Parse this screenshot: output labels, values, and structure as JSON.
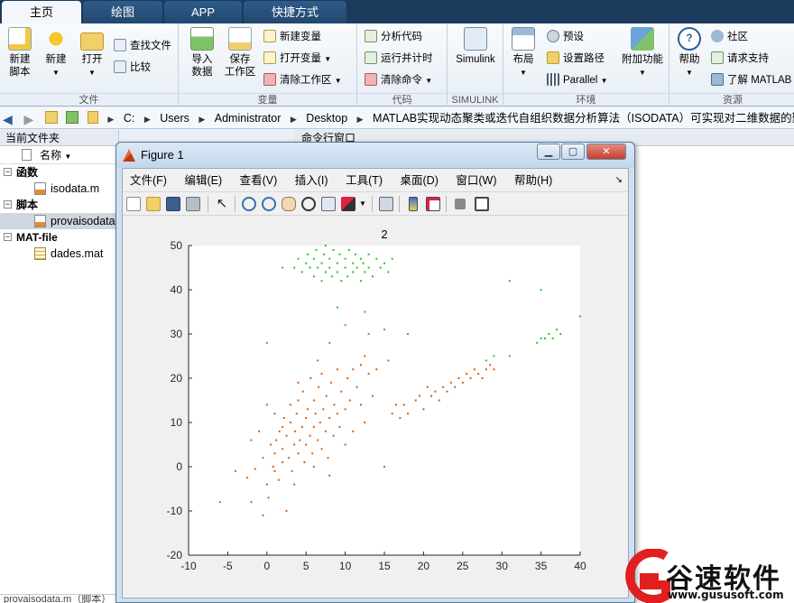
{
  "tabs": [
    {
      "label": "主页",
      "active": true
    },
    {
      "label": "绘图",
      "active": false
    },
    {
      "label": "APP",
      "active": false
    },
    {
      "label": "快捷方式",
      "active": false
    }
  ],
  "ribbon": {
    "file": {
      "label": "文件",
      "new_script": "新建\n脚本",
      "new": "新建",
      "open": "打开",
      "find_files": "查找文件",
      "compare": "比较"
    },
    "variable": {
      "label": "变量",
      "import": "导入\n数据",
      "save": "保存\n工作区",
      "new_var": "新建变量",
      "open_var": "打开变量",
      "clear_ws": "清除工作区"
    },
    "code": {
      "label": "代码",
      "analyze": "分析代码",
      "run_time": "运行并计时",
      "clear_cmd": "清除命令"
    },
    "simulink": {
      "label": "SIMULINK",
      "simulink": "Simulink"
    },
    "env": {
      "label": "环境",
      "layout": "布局",
      "prefs": "预设",
      "set_path": "设置路径",
      "parallel": "Parallel",
      "addons": "附加功能"
    },
    "resources": {
      "label": "资源",
      "help": "帮助",
      "community": "社区",
      "request_support": "请求支持",
      "learn": "了解 MATLAB"
    }
  },
  "address": {
    "crumbs": [
      "C:",
      "Users",
      "Administrator",
      "Desktop",
      "MATLAB实现动态聚类或迭代自组织数据分析算法（ISODATA）可实现对二维数据的聚类"
    ]
  },
  "file_panel": {
    "title": "当前文件夹",
    "col_name": "名称",
    "sections": [
      {
        "label": "函数",
        "files": [
          {
            "name": "isodata.m",
            "selected": false
          }
        ]
      },
      {
        "label": "脚本",
        "files": [
          {
            "name": "provaisodata.m",
            "selected": true
          }
        ]
      },
      {
        "label": "MAT-file",
        "files": [
          {
            "name": "dades.mat",
            "selected": false
          }
        ]
      }
    ],
    "footer": "provaisodata.m（脚本）"
  },
  "command_window": {
    "title": "命令行窗口"
  },
  "figure": {
    "title": "Figure 1",
    "menus": [
      "文件(F)",
      "编辑(E)",
      "查看(V)",
      "插入(I)",
      "工具(T)",
      "桌面(D)",
      "窗口(W)",
      "帮助(H)"
    ]
  },
  "chart_data": {
    "type": "scatter",
    "title": "2",
    "xlim": [
      -10,
      40
    ],
    "ylim": [
      -20,
      50
    ],
    "xticks": [
      -10,
      -5,
      0,
      5,
      10,
      15,
      20,
      25,
      30,
      35,
      40
    ],
    "yticks": [
      -20,
      -10,
      0,
      10,
      20,
      30,
      40,
      50
    ],
    "grid": false,
    "colors": {
      "cluster1": "#d95f02",
      "cluster2": "#1ec81e"
    },
    "series": [
      {
        "color_key": "cluster1",
        "points": [
          [
            -6,
            -8
          ],
          [
            -4,
            -1
          ],
          [
            -2.5,
            -2.5
          ],
          [
            -2,
            -8
          ],
          [
            -1.5,
            -0.5
          ],
          [
            -1,
            8
          ],
          [
            -0.5,
            2
          ],
          [
            -0.5,
            -11
          ],
          [
            0,
            -4
          ],
          [
            0.2,
            -7
          ],
          [
            0.5,
            5
          ],
          [
            0.8,
            0
          ],
          [
            1,
            -1
          ],
          [
            1,
            3
          ],
          [
            1.2,
            6
          ],
          [
            1.5,
            -3
          ],
          [
            1.6,
            8
          ],
          [
            2,
            1
          ],
          [
            2,
            4
          ],
          [
            2.2,
            11
          ],
          [
            2.5,
            7
          ],
          [
            2.8,
            2
          ],
          [
            3,
            10
          ],
          [
            3,
            14
          ],
          [
            3.2,
            -1
          ],
          [
            3.5,
            5
          ],
          [
            3.6,
            8
          ],
          [
            3.8,
            12
          ],
          [
            4,
            3
          ],
          [
            4,
            15
          ],
          [
            4.2,
            6
          ],
          [
            4.5,
            9
          ],
          [
            4.6,
            17
          ],
          [
            4.8,
            1
          ],
          [
            5,
            11
          ],
          [
            5,
            5
          ],
          [
            5.2,
            13
          ],
          [
            5.5,
            7
          ],
          [
            5.6,
            20
          ],
          [
            5.8,
            3
          ],
          [
            6,
            9
          ],
          [
            6,
            15
          ],
          [
            6.2,
            12
          ],
          [
            6.5,
            6
          ],
          [
            6.6,
            18
          ],
          [
            6.8,
            10
          ],
          [
            7,
            4
          ],
          [
            7,
            21
          ],
          [
            7.2,
            13
          ],
          [
            7.5,
            8
          ],
          [
            7.6,
            16
          ],
          [
            7.8,
            2
          ],
          [
            8,
            11
          ],
          [
            8.2,
            19
          ],
          [
            8.5,
            7
          ],
          [
            8.6,
            14
          ],
          [
            9,
            12
          ],
          [
            9,
            22
          ],
          [
            9.3,
            9
          ],
          [
            9.5,
            17
          ],
          [
            10,
            13
          ],
          [
            10,
            5
          ],
          [
            10.3,
            20
          ],
          [
            10.6,
            15
          ],
          [
            11,
            22
          ],
          [
            11,
            8
          ],
          [
            11.5,
            18
          ],
          [
            12,
            14
          ],
          [
            12,
            23
          ],
          [
            12.5,
            10
          ],
          [
            13,
            21
          ],
          [
            13.5,
            16
          ],
          [
            14,
            22
          ],
          [
            15,
            0
          ],
          [
            16,
            12
          ],
          [
            16.5,
            14
          ],
          [
            17,
            11
          ],
          [
            17.5,
            14
          ],
          [
            18,
            12
          ],
          [
            19,
            15
          ],
          [
            19.5,
            16
          ],
          [
            20,
            13
          ],
          [
            20.5,
            18
          ],
          [
            21,
            16
          ],
          [
            21.5,
            17
          ],
          [
            22,
            15
          ],
          [
            22.5,
            18
          ],
          [
            23,
            17
          ],
          [
            23.5,
            19
          ],
          [
            24,
            18
          ],
          [
            24.5,
            20
          ],
          [
            25,
            19
          ],
          [
            25.5,
            21
          ],
          [
            26,
            20
          ],
          [
            26.5,
            22
          ],
          [
            27,
            21
          ],
          [
            27.5,
            20
          ],
          [
            28,
            22
          ],
          [
            28.5,
            23
          ],
          [
            29,
            22
          ],
          [
            1,
            12
          ],
          [
            2,
            9
          ],
          [
            3.5,
            -4
          ],
          [
            6,
            0
          ],
          [
            8,
            -2
          ],
          [
            -2,
            6
          ],
          [
            0,
            14
          ],
          [
            4,
            19
          ],
          [
            6.5,
            24
          ],
          [
            12.5,
            25
          ],
          [
            15.5,
            24
          ],
          [
            2.5,
            -10
          ]
        ]
      },
      {
        "color_key": "cluster2",
        "points": [
          [
            3.5,
            45
          ],
          [
            4,
            47
          ],
          [
            4.5,
            44
          ],
          [
            5,
            46
          ],
          [
            5.2,
            48
          ],
          [
            5.5,
            45
          ],
          [
            6,
            43
          ],
          [
            6,
            47
          ],
          [
            6.3,
            49
          ],
          [
            6.5,
            45
          ],
          [
            7,
            46
          ],
          [
            7,
            42
          ],
          [
            7.3,
            48
          ],
          [
            7.5,
            44
          ],
          [
            8,
            47
          ],
          [
            8,
            45
          ],
          [
            8.3,
            43
          ],
          [
            8.5,
            49
          ],
          [
            9,
            46
          ],
          [
            9,
            44
          ],
          [
            9.3,
            48
          ],
          [
            9.5,
            42
          ],
          [
            10,
            45
          ],
          [
            10,
            47
          ],
          [
            10.3,
            43
          ],
          [
            10.5,
            49
          ],
          [
            11,
            46
          ],
          [
            11,
            44
          ],
          [
            11.3,
            48
          ],
          [
            11.5,
            45
          ],
          [
            12,
            47
          ],
          [
            12,
            42
          ],
          [
            12.3,
            46
          ],
          [
            12.5,
            44
          ],
          [
            13,
            48
          ],
          [
            13,
            45
          ],
          [
            13.5,
            43
          ],
          [
            14,
            47
          ],
          [
            14.5,
            45
          ],
          [
            15,
            46
          ],
          [
            15.5,
            44
          ],
          [
            16,
            47
          ],
          [
            2,
            45
          ],
          [
            7.5,
            50
          ],
          [
            9,
            36
          ],
          [
            10,
            32
          ],
          [
            12.5,
            35
          ],
          [
            0,
            28
          ],
          [
            13,
            30
          ],
          [
            15,
            31
          ],
          [
            18,
            30
          ],
          [
            28,
            24
          ],
          [
            29,
            25
          ],
          [
            31,
            25
          ],
          [
            34.5,
            28
          ],
          [
            35,
            29
          ],
          [
            35.5,
            29
          ],
          [
            36,
            30
          ],
          [
            36.5,
            29
          ],
          [
            37,
            31
          ],
          [
            37.5,
            30
          ],
          [
            40,
            34
          ],
          [
            35,
            40
          ],
          [
            31,
            42
          ],
          [
            8,
            28
          ]
        ]
      }
    ]
  },
  "watermark": {
    "brand": "谷速软件",
    "url": "www.gususoft.com",
    "colors": {
      "red": "#e02020",
      "dark": "#111111"
    }
  }
}
